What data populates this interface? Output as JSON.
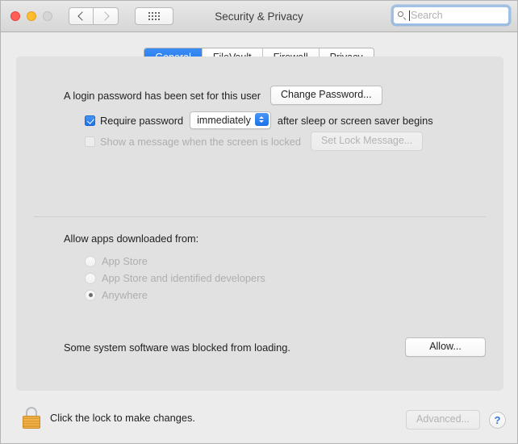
{
  "window": {
    "title": "Security & Privacy",
    "traffic_lights": [
      "close",
      "minimize",
      "zoom-disabled"
    ],
    "back_label": "Back",
    "forward_label": "Forward",
    "showall_label": "Show All"
  },
  "search": {
    "placeholder": "Search",
    "value": ""
  },
  "tabs": [
    {
      "label": "General",
      "active": true
    },
    {
      "label": "FileVault",
      "active": false
    },
    {
      "label": "Firewall",
      "active": false
    },
    {
      "label": "Privacy",
      "active": false
    }
  ],
  "general": {
    "login_password_text": "A login password has been set for this user",
    "change_password_label": "Change Password...",
    "require_password_label": "Require password",
    "require_password_checked": true,
    "require_password_delay": "immediately",
    "require_password_suffix": "after sleep or screen saver begins",
    "show_message_label": "Show a message when the screen is locked",
    "show_message_checked": false,
    "set_lock_message_label": "Set Lock Message...",
    "allow_apps_title": "Allow apps downloaded from:",
    "allow_apps_options": [
      {
        "label": "App Store",
        "selected": false
      },
      {
        "label": "App Store and identified developers",
        "selected": false
      },
      {
        "label": "Anywhere",
        "selected": true
      }
    ],
    "blocked_software_text": "Some system software was blocked from loading.",
    "allow_button_label": "Allow..."
  },
  "footer": {
    "lock_text": "Click the lock to make changes.",
    "advanced_label": "Advanced...",
    "help_label": "?"
  },
  "colors": {
    "accent": "#1a72e8",
    "window_bg": "#ececec",
    "panel_bg": "#e1e1e1",
    "lock_gold": "#e09c33",
    "help_blue": "#3c74d8"
  }
}
